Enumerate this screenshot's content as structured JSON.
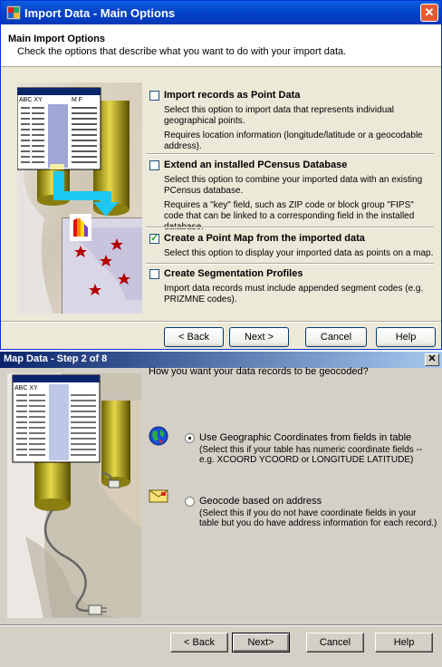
{
  "dialog1": {
    "title": "Import Data - Main Options",
    "close_glyph": "✕",
    "header": {
      "title": "Main Import Options",
      "subtitle": "Check the options that describe what you want to do with your import data."
    },
    "illustration_labels": {
      "abc_xy": "ABC XY",
      "m_f": "M    F"
    },
    "options": [
      {
        "label": "Import records as  Point Data",
        "checked": false,
        "desc1": "Select this option to import data that represents individual geographical points.",
        "desc2": "Requires location information (longitude/latitude or a geocodable address)."
      },
      {
        "label": "Extend an installed PCensus Database",
        "checked": false,
        "desc1": "Select this option to combine your imported data with an existing PCensus database.",
        "desc2": "Requires a \"key\" field, such as ZIP code or block group \"FIPS\" code that can be linked to a corresponding field in the installed database."
      },
      {
        "label": "Create a Point Map from the imported data",
        "checked": true,
        "desc1": "Select this option to display your imported data as points on a map.",
        "desc2": ""
      },
      {
        "label": "Create Segmentation Profiles",
        "checked": false,
        "desc1": "Import data records must include appended segment codes (e.g. PRIZMNE codes).",
        "desc2": ""
      }
    ],
    "buttons": {
      "back": "< Back",
      "next": "Next >",
      "cancel": "Cancel",
      "help": "Help"
    }
  },
  "dialog2": {
    "title": "Map Data - Step 2 of 8",
    "close_glyph": "✕",
    "question": "How you want your data records to be geocoded?",
    "illustration_labels": {
      "abc_xy": "ABC XY"
    },
    "options": [
      {
        "label": "Use Geographic Coordinates from fields in table",
        "selected": true,
        "desc": "(Select this if your table has numeric coordinate fields -- e.g. XCOORD YCOORD or LONGITUDE LATITUDE)"
      },
      {
        "label": "Geocode based on address",
        "selected": false,
        "desc": "(Select this if you do not have coordinate fields in your table but you do have address information for each record.)"
      }
    ],
    "buttons": {
      "back": "< Back",
      "next": "Next>",
      "cancel": "Cancel",
      "help": "Help"
    }
  },
  "colors": {
    "xp_title": "#0343c6",
    "xp_face": "#ece9d8",
    "classic_face": "#d4d0c8",
    "classic_title": "#0a246a",
    "arrow": "#1ec8f0"
  }
}
